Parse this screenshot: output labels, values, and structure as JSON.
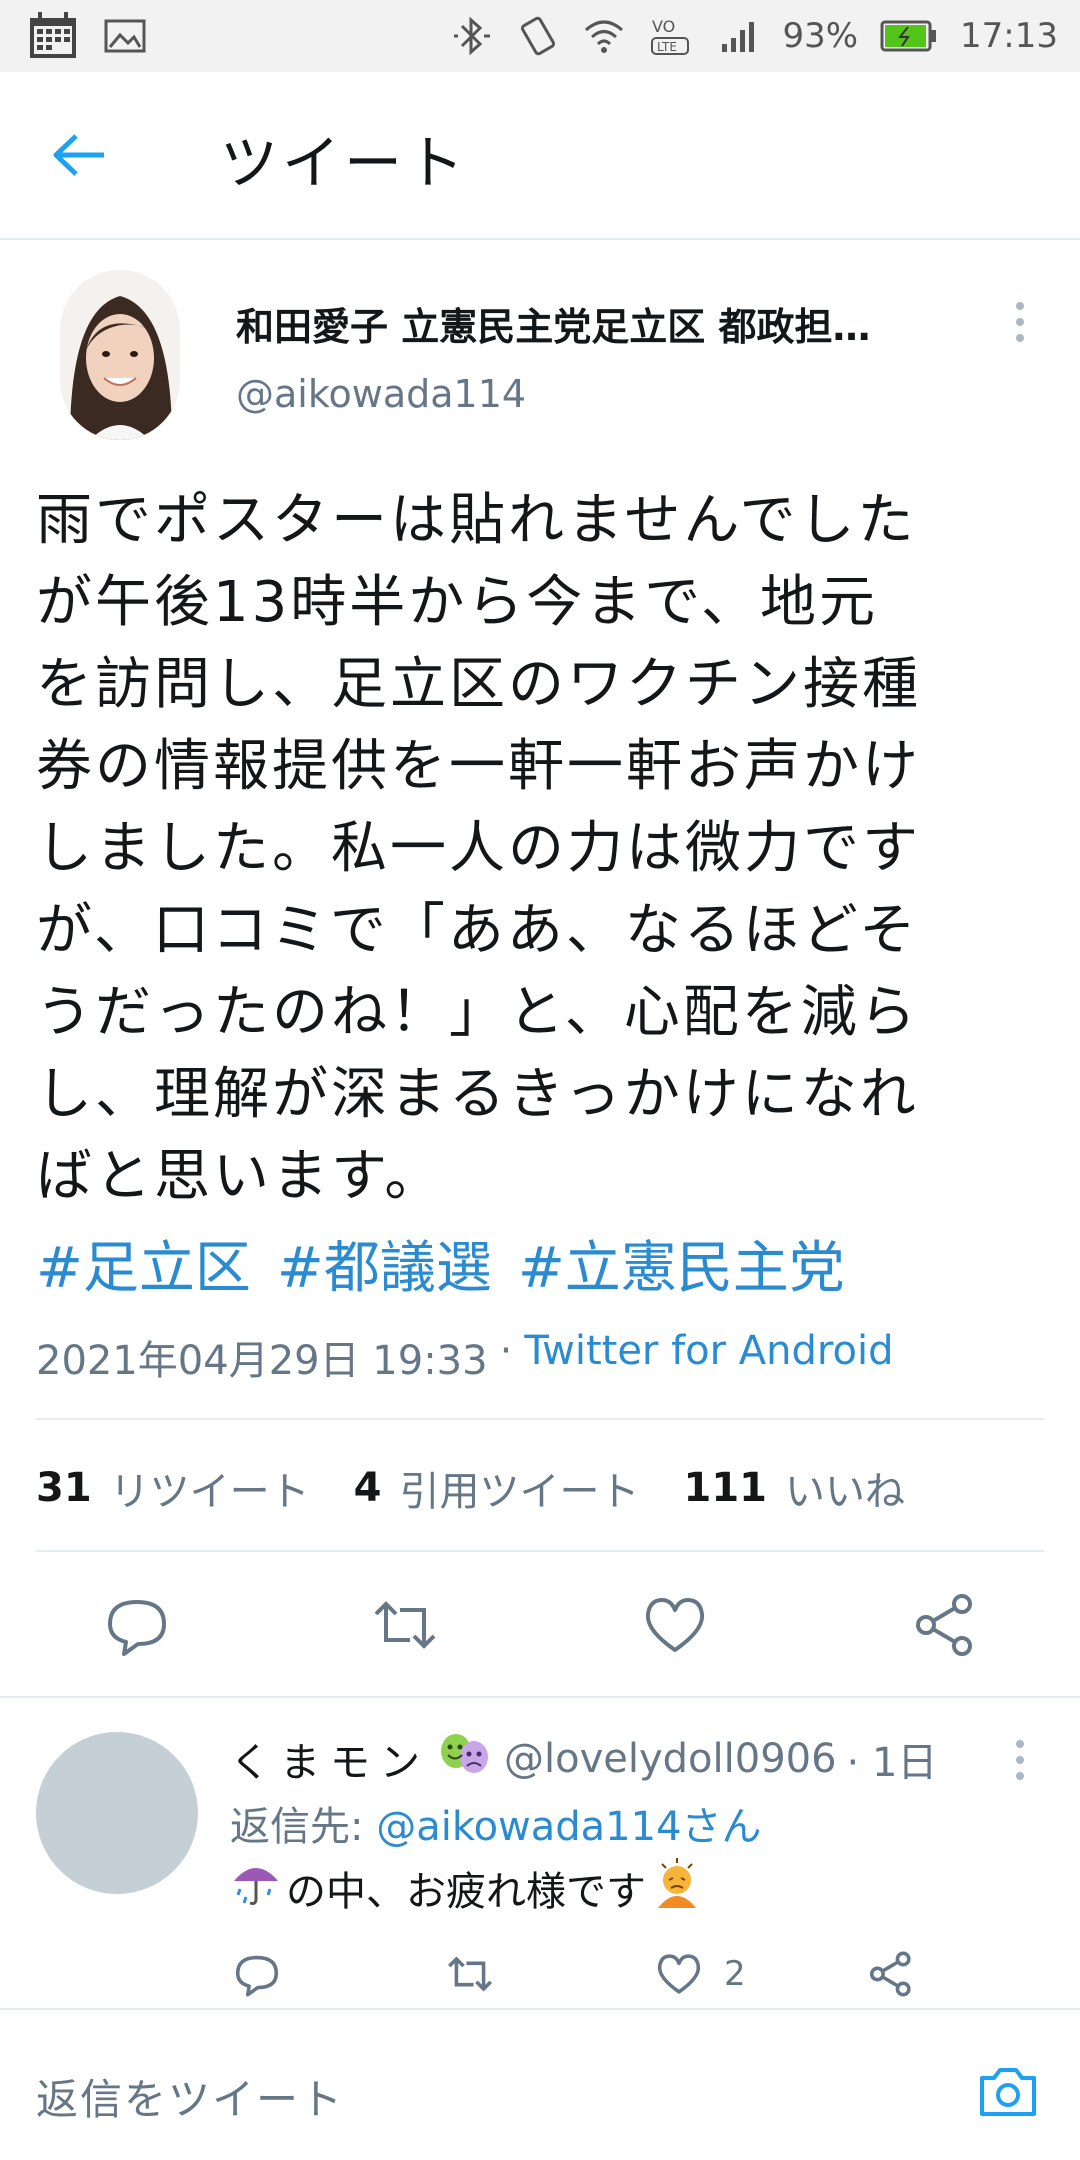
{
  "status_bar": {
    "battery_percent": "93%",
    "time": "17:13",
    "network_label": "LTE"
  },
  "header": {
    "title": "ツイート"
  },
  "tweet": {
    "author_name": "和田愛子 立憲民主党足立区 都政担…",
    "author_handle": "@aikowada114",
    "text": "雨でポスターは貼れませんでした\nが午後13時半から今まで、地元\nを訪問し、足立区のワクチン接種\n券の情報提供を一軒一軒お声かけ\nしました。私一人の力は微力です\nが、口コミで「ああ、なるほどそ\nうだったのね！」と、心配を減ら\nし、理解が深まるきっかけになれ\nばと思います。",
    "hashtags": [
      "#足立区",
      "#都議選",
      "#立憲民主党"
    ],
    "timestamp": "2021年04月29日 19:33",
    "separator": "·",
    "source": "Twitter for Android",
    "stats": {
      "retweets_count": "31",
      "retweets_label": "リツイート",
      "quotes_count": "4",
      "quotes_label": "引用ツイート",
      "likes_count": "111",
      "likes_label": "いいね"
    }
  },
  "reply": {
    "name": "くまモン",
    "handle": "@lovelydoll0906",
    "time": "· 1日",
    "replying_to_label": "返信先: ",
    "replying_to_handle": "@aikowada114さん",
    "text": "の中、お疲れ様です",
    "like_count": "2"
  },
  "compose": {
    "placeholder": "返信をツイート"
  },
  "colors": {
    "accent": "#1da1f2",
    "link": "#2a8bd0",
    "muted": "#657786",
    "text": "#14171a",
    "divider": "#e6ecf0",
    "battery": "#52c41a"
  }
}
